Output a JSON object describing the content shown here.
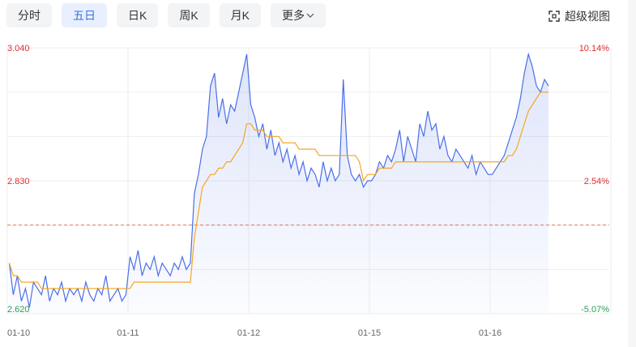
{
  "tabs": [
    {
      "label": "分时",
      "active": false
    },
    {
      "label": "五日",
      "active": true
    },
    {
      "label": "日K",
      "active": false
    },
    {
      "label": "周K",
      "active": false
    },
    {
      "label": "月K",
      "active": false
    },
    {
      "label": "更多",
      "active": false,
      "dropdown": true
    }
  ],
  "fullview": {
    "label": "超级视图",
    "icon": "fullscreen-icon"
  },
  "colors": {
    "price_line": "#4a6fe8",
    "avg_line": "#f5a623",
    "up": "#e03030",
    "down": "#2a9d55",
    "ref_line": "#e07a50",
    "highlight_box": "#d9262c"
  },
  "chart_data": {
    "type": "line",
    "x_ticks": [
      "01-10",
      "01-11",
      "01-12",
      "01-15",
      "01-16"
    ],
    "y_left_ticks": [
      "3.040",
      "2.830",
      "2.620"
    ],
    "y_right_ticks": [
      "10.14%",
      "2.54%",
      "-5.07%"
    ],
    "ylim": [
      2.62,
      3.04
    ],
    "reference_price": 2.76,
    "days": 5,
    "points_per_day": 30,
    "series": [
      {
        "values": [
          2.7,
          2.65,
          2.68,
          2.64,
          2.66,
          2.63,
          2.67,
          2.66,
          2.65,
          2.68,
          2.64,
          2.66,
          2.65,
          2.67,
          2.64,
          2.66,
          2.65,
          2.66,
          2.64,
          2.67,
          2.65,
          2.64,
          2.66,
          2.65,
          2.68,
          2.64,
          2.65,
          2.66,
          2.64,
          2.65,
          2.71,
          2.69,
          2.72,
          2.68,
          2.7,
          2.69,
          2.71,
          2.68,
          2.7,
          2.69,
          2.68,
          2.7,
          2.69,
          2.71,
          2.69,
          2.7,
          2.81,
          2.84,
          2.88,
          2.9,
          2.98,
          3.0,
          2.93,
          2.96,
          2.92,
          2.95,
          2.94,
          2.97,
          3.0,
          3.03,
          2.95,
          2.93,
          2.9,
          2.92,
          2.88,
          2.91,
          2.87,
          2.89,
          2.86,
          2.88,
          2.85,
          2.87,
          2.84,
          2.86,
          2.83,
          2.85,
          2.84,
          2.82,
          2.86,
          2.83,
          2.85,
          2.83,
          2.84,
          2.99,
          2.87,
          2.84,
          2.83,
          2.84,
          2.82,
          2.83,
          2.83,
          2.84,
          2.86,
          2.85,
          2.87,
          2.86,
          2.88,
          2.91,
          2.86,
          2.9,
          2.88,
          2.86,
          2.92,
          2.9,
          2.94,
          2.91,
          2.92,
          2.88,
          2.9,
          2.87,
          2.86,
          2.88,
          2.87,
          2.86,
          2.85,
          2.87,
          2.84,
          2.86,
          2.85,
          2.84,
          2.84,
          2.85,
          2.86,
          2.87,
          2.89,
          2.91,
          2.93,
          2.96,
          3.0,
          3.03,
          3.01,
          2.98,
          2.97,
          2.99,
          2.98
        ]
      },
      {
        "values": [
          2.7,
          2.68,
          2.68,
          2.67,
          2.67,
          2.67,
          2.67,
          2.67,
          2.66,
          2.66,
          2.66,
          2.66,
          2.66,
          2.66,
          2.66,
          2.66,
          2.66,
          2.66,
          2.66,
          2.66,
          2.66,
          2.66,
          2.66,
          2.66,
          2.66,
          2.66,
          2.66,
          2.66,
          2.66,
          2.66,
          2.66,
          2.67,
          2.67,
          2.67,
          2.67,
          2.67,
          2.67,
          2.67,
          2.67,
          2.67,
          2.67,
          2.67,
          2.67,
          2.67,
          2.67,
          2.67,
          2.74,
          2.78,
          2.82,
          2.83,
          2.84,
          2.84,
          2.85,
          2.85,
          2.86,
          2.86,
          2.87,
          2.88,
          2.89,
          2.92,
          2.92,
          2.91,
          2.91,
          2.91,
          2.9,
          2.9,
          2.9,
          2.9,
          2.89,
          2.89,
          2.89,
          2.89,
          2.88,
          2.88,
          2.88,
          2.88,
          2.88,
          2.87,
          2.87,
          2.87,
          2.87,
          2.87,
          2.87,
          2.87,
          2.87,
          2.87,
          2.87,
          2.86,
          2.83,
          2.84,
          2.84,
          2.84,
          2.85,
          2.85,
          2.85,
          2.85,
          2.86,
          2.86,
          2.86,
          2.86,
          2.86,
          2.86,
          2.86,
          2.86,
          2.86,
          2.86,
          2.86,
          2.86,
          2.86,
          2.86,
          2.86,
          2.86,
          2.86,
          2.86,
          2.86,
          2.86,
          2.86,
          2.86,
          2.86,
          2.86,
          2.86,
          2.86,
          2.86,
          2.86,
          2.87,
          2.87,
          2.88,
          2.9,
          2.92,
          2.94,
          2.95,
          2.96,
          2.97,
          2.97,
          2.97
        ]
      }
    ],
    "highlight": {
      "x_start_index": 135,
      "x_end_index": 145
    }
  }
}
